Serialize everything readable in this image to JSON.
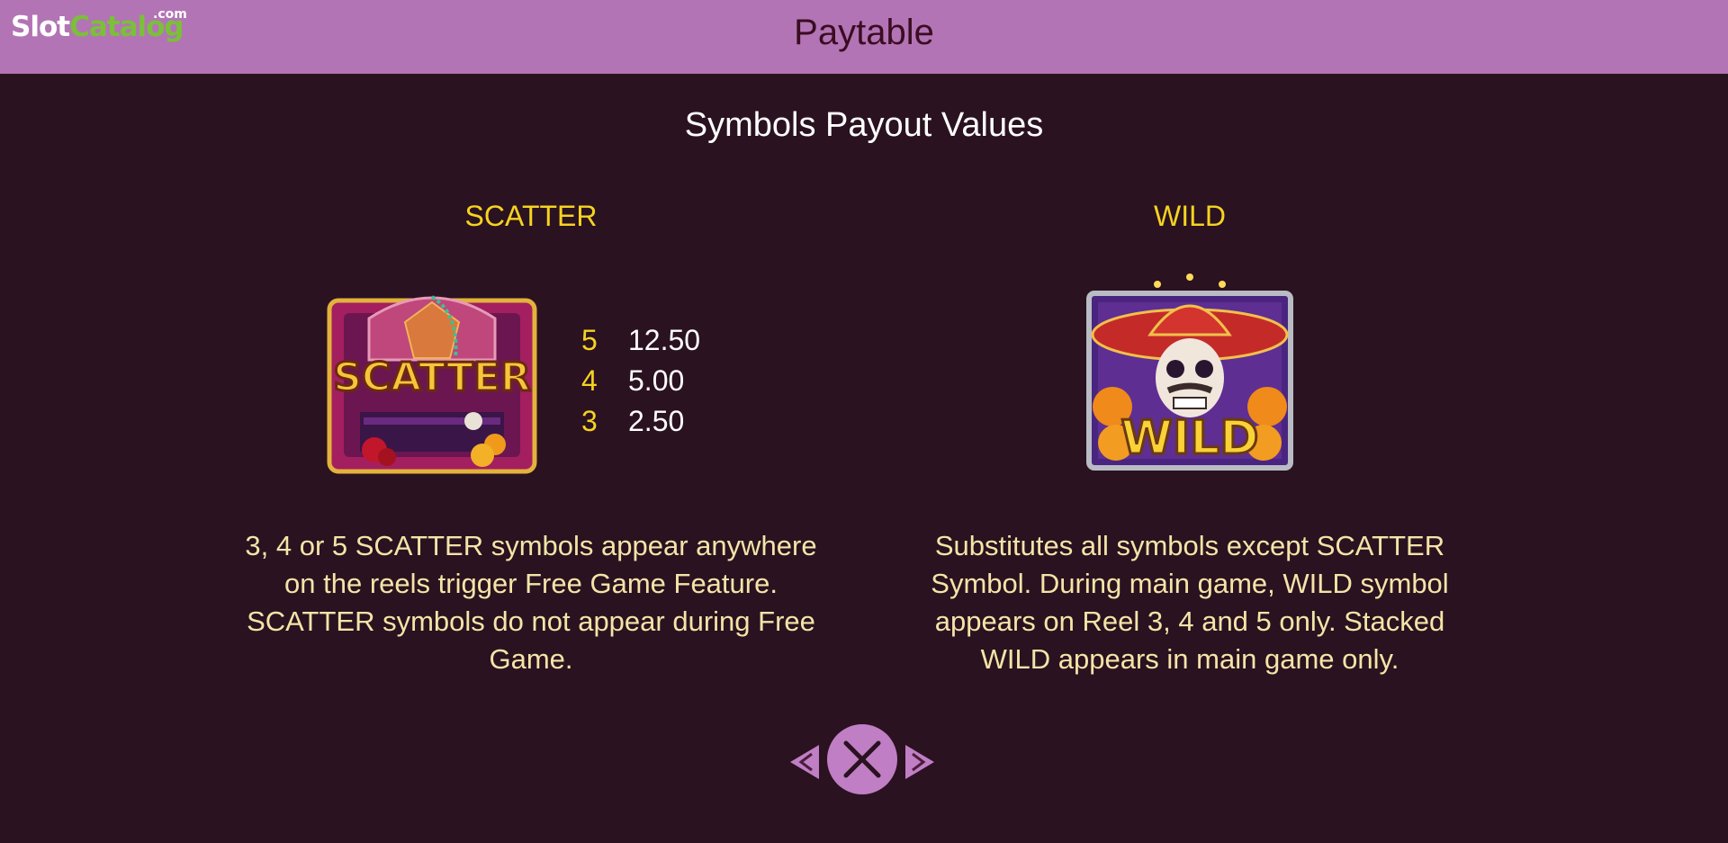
{
  "header": {
    "logo_slot": "Slot",
    "logo_catalog": "Catalog",
    "logo_com": ".com",
    "title": "Paytable"
  },
  "section_title": "Symbols Payout Values",
  "symbols": [
    {
      "name": "SCATTER",
      "image_label": "SCATTER",
      "pays": [
        {
          "count": "5",
          "value": "12.50"
        },
        {
          "count": "4",
          "value": "5.00"
        },
        {
          "count": "3",
          "value": "2.50"
        }
      ],
      "description": "3, 4 or 5 SCATTER symbols appear anywhere on the reels trigger Free Game Feature. SCATTER symbols do not appear during Free Game."
    },
    {
      "name": "WILD",
      "image_label": "WILD",
      "description": "Substitutes all symbols except SCATTER Symbol. During main game, WILD symbol appears on Reel 3, 4 and 5 only. Stacked WILD appears in main game only."
    }
  ],
  "colors": {
    "header_bg": "#b374b5",
    "page_bg": "#2a1220",
    "accent_yellow": "#f5d320",
    "description_text": "#f5e4a8",
    "nav_button": "#c07ec4"
  },
  "nav": {
    "prev_icon": "chevron-left-icon",
    "close_icon": "close-icon",
    "next_icon": "chevron-right-icon"
  }
}
